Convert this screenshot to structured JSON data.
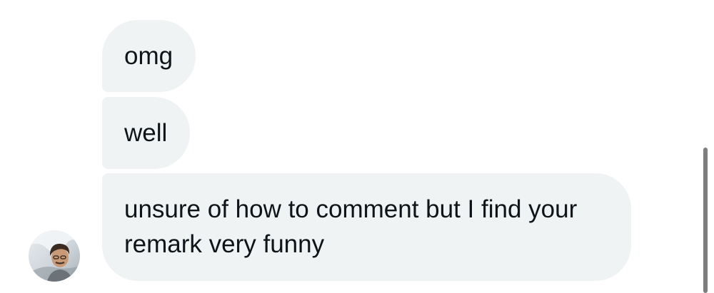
{
  "conversation": {
    "messages": [
      {
        "text": "omg"
      },
      {
        "text": "well"
      },
      {
        "text": "unsure of how to comment but I find your remark very funny"
      }
    ]
  },
  "colors": {
    "bubble_background": "#eff3f4",
    "text": "#0f1419",
    "scrollbar": "#7f7f7f",
    "page_background": "#ffffff"
  },
  "icons": {
    "avatar": "user-avatar-photo"
  }
}
